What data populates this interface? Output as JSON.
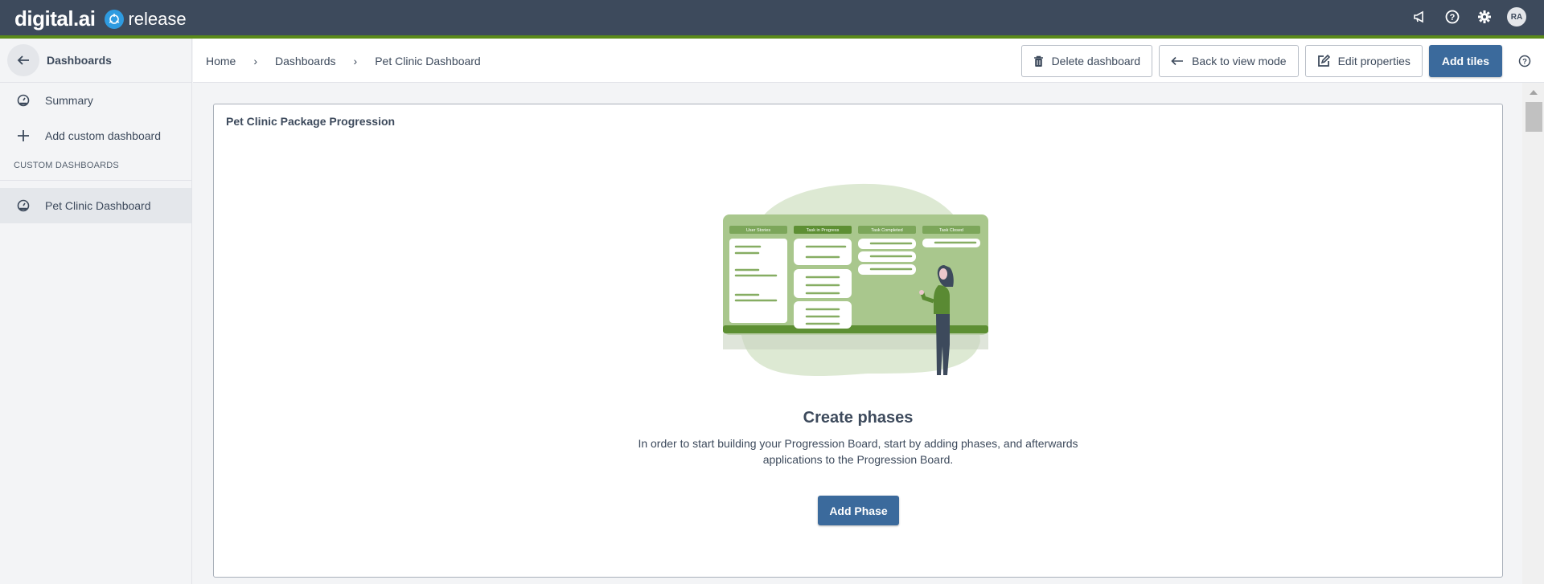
{
  "topbar": {
    "brand": "digital.ai",
    "product": "release",
    "icons": [
      "announcements-icon",
      "help-icon",
      "settings-icon"
    ],
    "avatar_initials": "RA",
    "accent_color": "#5a8a1a",
    "bar_color": "#3d4a5c"
  },
  "sidebar": {
    "title": "Dashboards",
    "items": [
      {
        "label": "Summary",
        "icon": "dashboard-gauge-icon"
      },
      {
        "label": "Add custom dashboard",
        "icon": "plus-icon"
      }
    ],
    "section_label": "CUSTOM DASHBOARDS",
    "custom_dashboards": [
      {
        "label": "Pet Clinic Dashboard",
        "icon": "dashboard-gauge-icon",
        "active": true
      }
    ]
  },
  "header": {
    "breadcrumb": [
      "Home",
      "Dashboards",
      "Pet Clinic Dashboard"
    ],
    "actions": {
      "delete": "Delete dashboard",
      "back": "Back to view mode",
      "edit": "Edit properties",
      "add_tiles": "Add tiles"
    },
    "primary_color": "#3b6a9c"
  },
  "tile": {
    "title": "Pet Clinic Package Progression",
    "illustration_columns": [
      "User Stories",
      "Task in Progress",
      "Task Completed",
      "Task Closed"
    ],
    "empty_title": "Create phases",
    "empty_description": "In order to start building your Progression Board, start by adding phases, and afterwards applications to the Progression Board.",
    "add_phase_label": "Add Phase"
  }
}
